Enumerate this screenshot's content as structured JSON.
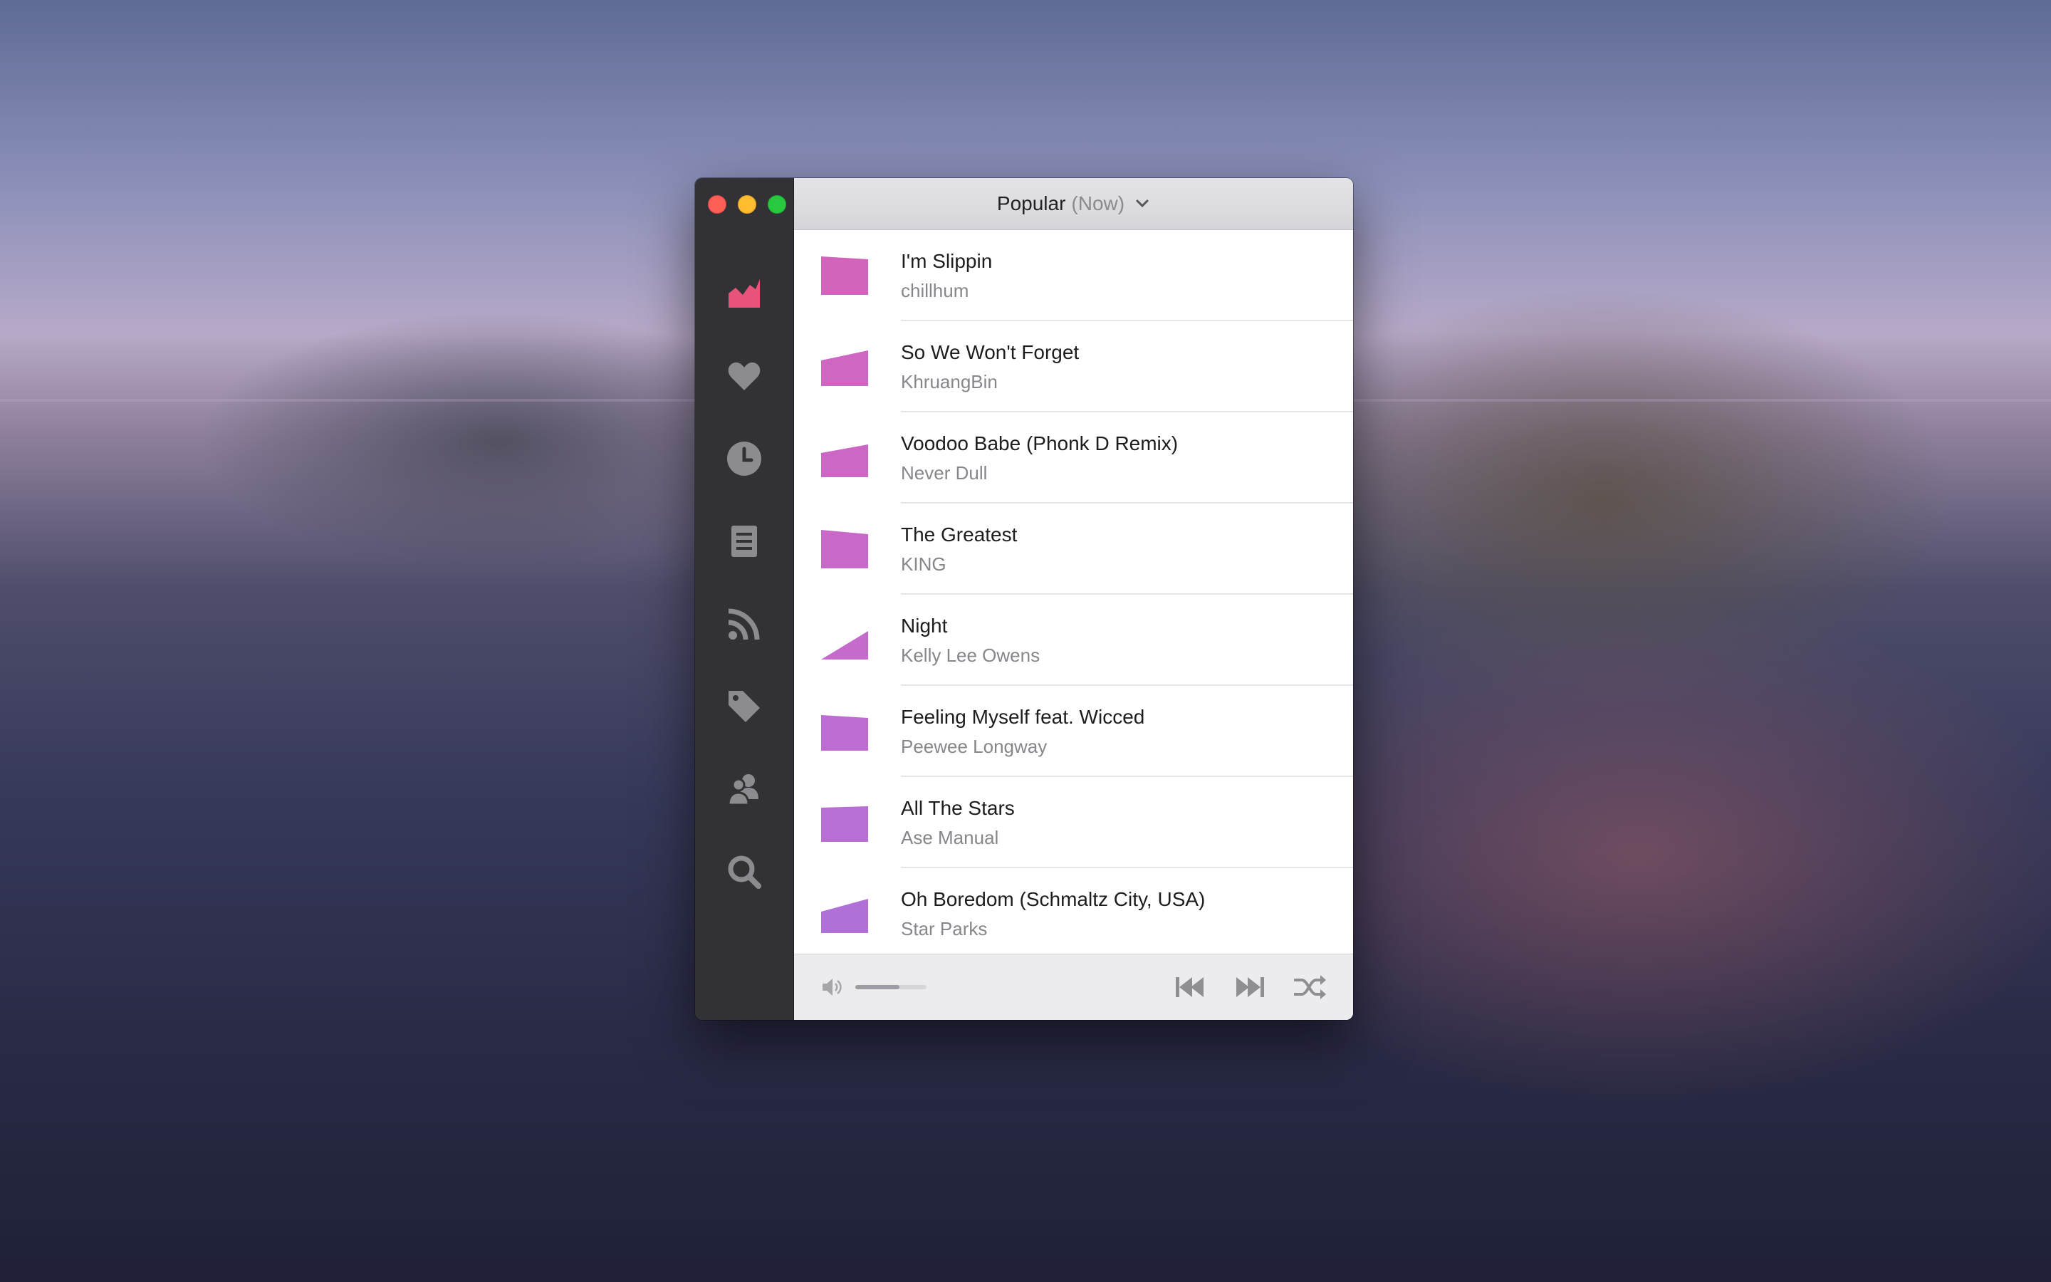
{
  "window": {
    "title": "Popular",
    "subtitle": "(Now)"
  },
  "sidebar": {
    "items": [
      {
        "icon": "chart-icon",
        "active": true
      },
      {
        "icon": "heart-icon"
      },
      {
        "icon": "clock-icon"
      },
      {
        "icon": "list-icon"
      },
      {
        "icon": "rss-icon"
      },
      {
        "icon": "tag-icon"
      },
      {
        "icon": "users-icon"
      },
      {
        "icon": "search-icon"
      }
    ]
  },
  "tracks": [
    {
      "title": "I'm Slippin",
      "artist": "chillhum",
      "color": "#d264bc"
    },
    {
      "title": "So We Won't Forget",
      "artist": "KhruangBin",
      "color": "#cf66c2"
    },
    {
      "title": "Voodoo Babe (Phonk D Remix)",
      "artist": "Never Dull",
      "color": "#cc67c5"
    },
    {
      "title": "The Greatest",
      "artist": "KING",
      "color": "#c869c9"
    },
    {
      "title": "Night",
      "artist": "Kelly Lee Owens",
      "color": "#c46bcc"
    },
    {
      "title": "Feeling Myself feat. Wicced",
      "artist": "Peewee Longway",
      "color": "#bd6dd1"
    },
    {
      "title": "All The Stars",
      "artist": "Ase Manual",
      "color": "#b86fd4"
    },
    {
      "title": "Oh Boredom (Schmaltz City, USA)",
      "artist": "Star Parks",
      "color": "#b070d8"
    }
  ],
  "player": {
    "volume": 0.62
  },
  "colors": {
    "accent": "#e8537a",
    "sidebar_bg": "#323236",
    "sidebar_icon": "#8b8b90"
  }
}
